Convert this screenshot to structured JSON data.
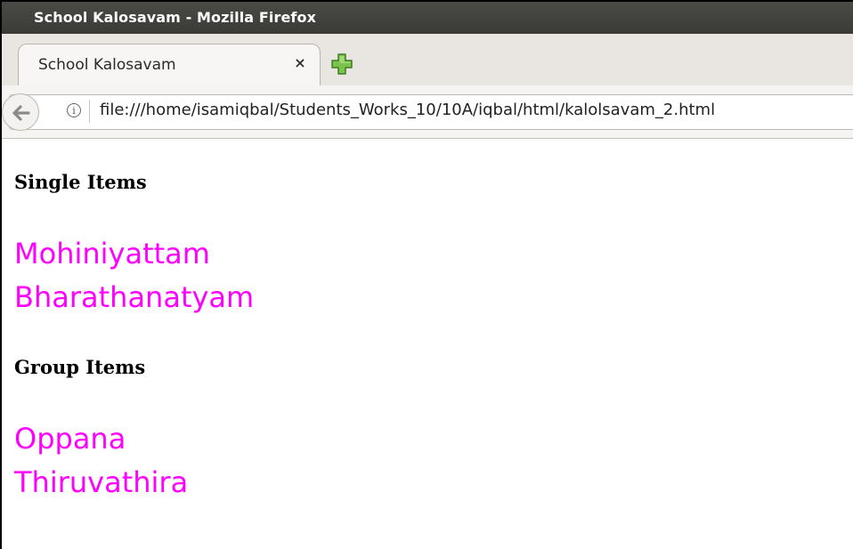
{
  "window": {
    "title": "School Kalosavam - Mozilla Firefox"
  },
  "tabs": [
    {
      "label": "School Kalosavam",
      "close_glyph": "×"
    }
  ],
  "navbar": {
    "url": "file:///home/isamiqbal/Students_Works_10/10A/iqbal/html/kalolsavam_2.html",
    "info_glyph": "i"
  },
  "page": {
    "sections": [
      {
        "heading": "Single Items",
        "items": [
          "Mohiniyattam",
          "Bharathanatyam"
        ]
      },
      {
        "heading": "Group Items",
        "items": [
          "Oppana",
          "Thiruvathira"
        ]
      }
    ]
  },
  "colors": {
    "item_text": "#ff00ff",
    "titlebar": "#3c3c38",
    "newtab_icon": "#6ab04c"
  },
  "icons": {
    "back": "back-arrow-icon",
    "info": "info-icon",
    "new_tab": "plus-icon",
    "close_tab": "close-icon"
  }
}
